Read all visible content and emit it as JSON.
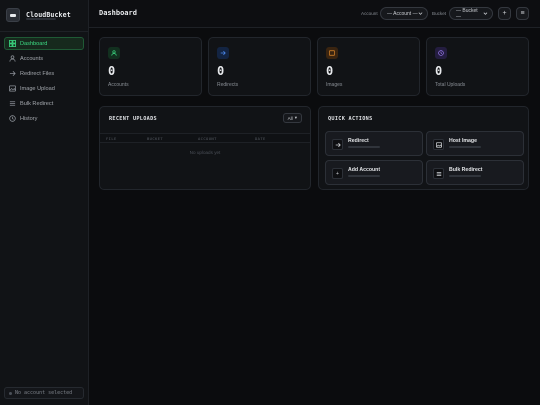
{
  "app": {
    "name": "CloudBucket"
  },
  "sidebar": {
    "items": [
      {
        "label": "Dashboard",
        "icon": "dashboard-icon",
        "active": true
      },
      {
        "label": "Accounts",
        "icon": "user-icon"
      },
      {
        "label": "Redirect Files",
        "icon": "arrow-right-icon"
      },
      {
        "label": "Image Upload",
        "icon": "image-icon"
      },
      {
        "label": "Bulk Redirect",
        "icon": "list-icon"
      },
      {
        "label": "History",
        "icon": "clock-icon"
      }
    ],
    "account_status": "No account selected"
  },
  "header": {
    "title": "Dashboard",
    "account_label": "Account",
    "account_select": "— Account —",
    "bucket_label": "Bucket",
    "bucket_select": "— Bucket —",
    "add_icon": "plus-icon",
    "menu_icon": "menu-icon"
  },
  "stats": [
    {
      "value": "0",
      "label": "Accounts",
      "icon": "user-icon",
      "color": "#3ddc84"
    },
    {
      "value": "0",
      "label": "Redirects",
      "icon": "arrow-right-icon",
      "color": "#4d8bf0"
    },
    {
      "value": "0",
      "label": "Images",
      "icon": "image-icon",
      "color": "#e08a2c"
    },
    {
      "value": "0",
      "label": "Total Uploads",
      "icon": "clock-icon",
      "color": "#9b7cf0"
    }
  ],
  "recent": {
    "title": "RECENT UPLOADS",
    "all_button": "All",
    "columns": [
      "FILE",
      "BUCKET",
      "ACCOUNT",
      "DATE"
    ],
    "empty_text": "No uploads yet"
  },
  "quick": {
    "title": "QUICK ACTIONS",
    "actions": [
      {
        "label": "Redirect",
        "icon": "arrow-right-icon"
      },
      {
        "label": "Host Image",
        "icon": "image-icon"
      },
      {
        "label": "Add Account",
        "icon": "plus-icon"
      },
      {
        "label": "Bulk Redirect",
        "icon": "list-icon"
      }
    ]
  }
}
